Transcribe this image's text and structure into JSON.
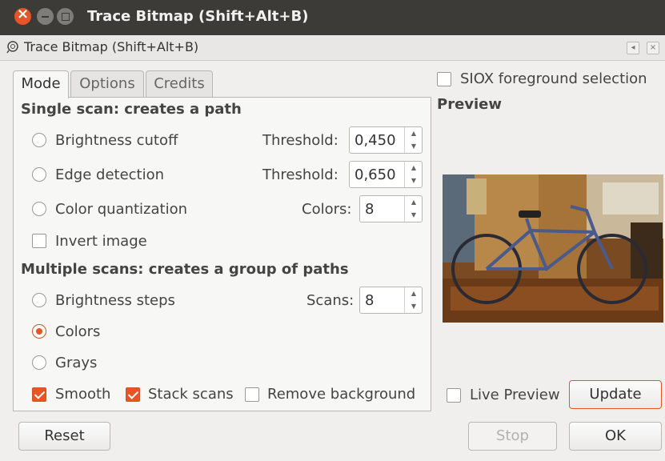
{
  "window": {
    "title": "Trace Bitmap (Shift+Alt+B)"
  },
  "dock": {
    "title": "Trace Bitmap (Shift+Alt+B)",
    "collapse_glyph": "◂",
    "close_glyph": "×"
  },
  "tabs": [
    {
      "label": "Mode",
      "active": true
    },
    {
      "label": "Options",
      "active": false
    },
    {
      "label": "Credits",
      "active": false
    }
  ],
  "single_scan": {
    "heading": "Single scan: creates a path",
    "brightness": {
      "label": "Brightness cutoff",
      "selected": false,
      "param_label": "Threshold:",
      "value": "0,450"
    },
    "edge": {
      "label": "Edge detection",
      "selected": false,
      "param_label": "Threshold:",
      "value": "0,650"
    },
    "color_quant": {
      "label": "Color quantization",
      "selected": false,
      "param_label": "Colors:",
      "value": "8"
    },
    "invert": {
      "label": "Invert image",
      "checked": false
    }
  },
  "multiple_scans": {
    "heading": "Multiple scans: creates a group of paths",
    "brightness_steps": {
      "label": "Brightness steps",
      "selected": false,
      "param_label": "Scans:",
      "value": "8"
    },
    "colors": {
      "label": "Colors",
      "selected": true
    },
    "grays": {
      "label": "Grays",
      "selected": false
    },
    "smooth": {
      "label": "Smooth",
      "checked": true
    },
    "stack": {
      "label": "Stack scans",
      "checked": true
    },
    "remove_bg": {
      "label": "Remove background",
      "checked": false
    }
  },
  "siox": {
    "label": "SIOX foreground selection",
    "checked": false
  },
  "preview": {
    "heading": "Preview"
  },
  "live_preview": {
    "label": "Live Preview",
    "checked": false
  },
  "buttons": {
    "update": "Update",
    "reset": "Reset",
    "stop": "Stop",
    "ok": "OK"
  },
  "colors": {
    "accent": "#e95420",
    "titlebar": "#3c3b37"
  }
}
